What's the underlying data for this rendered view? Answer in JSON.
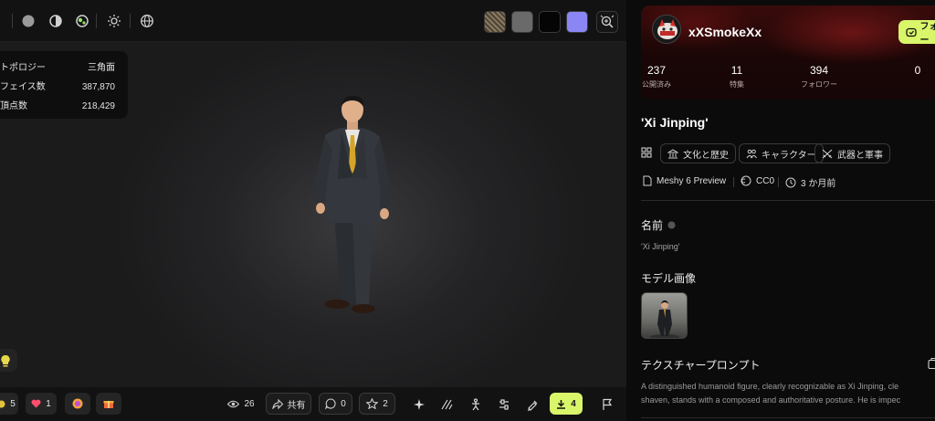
{
  "viewer": {
    "stats": [
      {
        "label": "トポロジー",
        "value": "三角面"
      },
      {
        "label": "フェイス数",
        "value": "387,870"
      },
      {
        "label": "頂点数",
        "value": "218,429"
      }
    ],
    "texture_swatches": [
      "#7d6e58",
      "#6a6a6a",
      "#050505",
      "#8a87f5"
    ],
    "bottom": {
      "likes_a": "5",
      "likes_b": "1",
      "views": "26",
      "share_label": "共有",
      "comments": "0",
      "stars": "2",
      "downloads": "4"
    }
  },
  "panel": {
    "username": "xXSmokeXx",
    "follow_label": "フォロー",
    "stats": [
      {
        "value": "237",
        "label": "公開済み"
      },
      {
        "value": "11",
        "label": "特集"
      },
      {
        "value": "394",
        "label": "フォロワー"
      },
      {
        "value": "0",
        "label": ""
      }
    ],
    "title": "'Xi Jinping'",
    "tags": [
      "文化と歴史",
      "キャラクター",
      "武器と軍事"
    ],
    "meta": {
      "model": "Meshy 6 Preview",
      "license": "CC0",
      "time": "3 か月前"
    },
    "name_label": "名前",
    "name_value": "'Xi Jinping'",
    "model_image_label": "モデル画像",
    "texture_prompt_label": "テクスチャープロンプト",
    "prompt_line1": "A distinguished humanoid figure, clearly recognizable as Xi Jinping, cle",
    "prompt_line2": "shaven, stands with a composed and authoritative posture. He is impec",
    "accent": "#d9f56a"
  }
}
